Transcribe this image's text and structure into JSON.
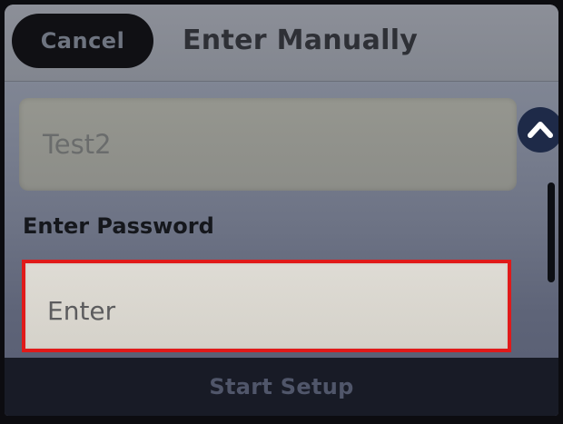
{
  "header": {
    "cancel_label": "Cancel",
    "title": "Enter Manually"
  },
  "network": {
    "ssid_value": "Test2"
  },
  "password": {
    "label": "Enter Password",
    "placeholder": "Enter"
  },
  "footer": {
    "start_label": "Start Setup"
  },
  "icons": {
    "scroll_up": "chevron-up-icon"
  },
  "colors": {
    "highlight_border": "#e01a1a",
    "scroll_button": "#1e2a48"
  }
}
